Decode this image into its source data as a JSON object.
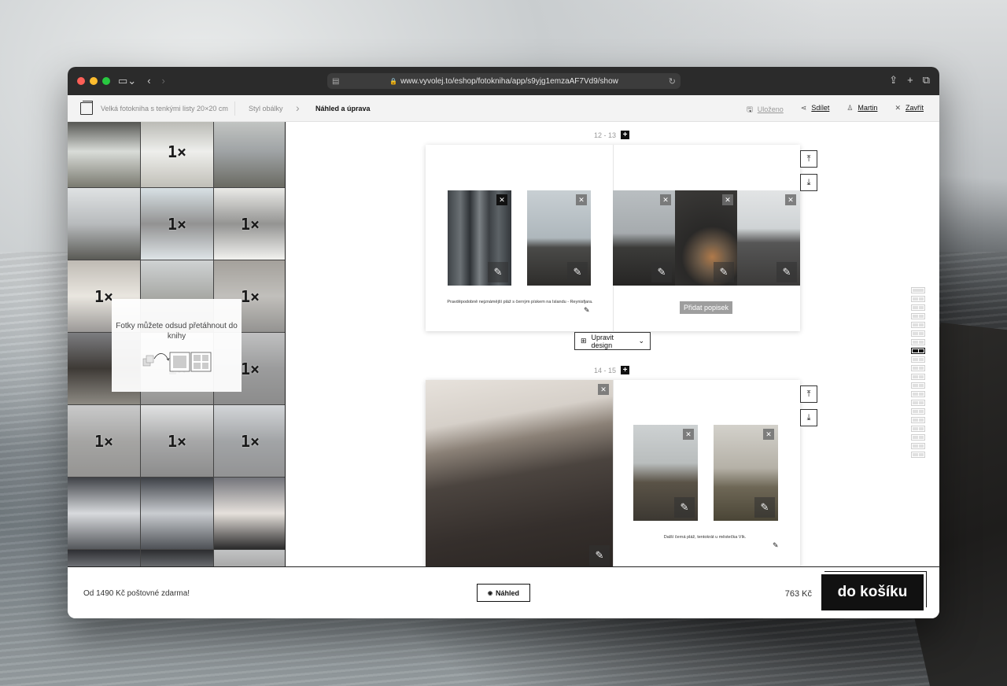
{
  "browser": {
    "url": "www.vyvolej.to/eshop/fotokniha/app/s9yjg1emzaAF7Vd9/show"
  },
  "appbar": {
    "product": "Velká fotokniha s tenkými listy 20×20 cm",
    "step_cover": "Styl obálky",
    "step_current": "Náhled a úprava",
    "saved": "Uloženo",
    "share": "Sdílet",
    "user": "Martin",
    "close": "Zavřít"
  },
  "sidebar": {
    "usage_badge": "1×",
    "tip_text": "Fotky můžete odsud přetáhnout do knihy",
    "thumbs": [
      {
        "used": false,
        "colors": [
          "#3a3a36",
          "#d9dcd8",
          "#7a7a70"
        ]
      },
      {
        "used": true,
        "colors": [
          "#6f6f65",
          "#e0e1dc",
          "#8d8b7d"
        ]
      },
      {
        "used": false,
        "colors": [
          "#c9cbc8",
          "#9fa3a5",
          "#6a6a62"
        ]
      },
      {
        "used": false,
        "colors": [
          "#dfe2e3",
          "#b8bbbd",
          "#5a5a55"
        ]
      },
      {
        "used": true,
        "colors": [
          "#b9c9d0",
          "#3a3a3a",
          "#c4cfd4"
        ]
      },
      {
        "used": true,
        "colors": [
          "#d9d9d4",
          "#3d3d3a",
          "#e8e8e3"
        ]
      },
      {
        "used": true,
        "colors": [
          "#8b8377",
          "#d8d2c6",
          "#4a4642"
        ]
      },
      {
        "used": false,
        "colors": [
          "#cfd2d3",
          "#a9aaa6",
          "#6f6e68"
        ]
      },
      {
        "used": true,
        "colors": [
          "#5a544a",
          "#8e8b84",
          "#3d3b37"
        ]
      },
      {
        "used": false,
        "colors": [
          "#7c7d80",
          "#3e3a36",
          "#8d8a83"
        ]
      },
      {
        "used": true,
        "colors": [
          "#b4b6b7",
          "#6f6f6c",
          "#3d3c3a"
        ]
      },
      {
        "used": true,
        "colors": [
          "#8c8d8e",
          "#4a4b4c",
          "#2e2e2e"
        ]
      },
      {
        "used": true,
        "colors": [
          "#9d9e9f",
          "#5c5b58",
          "#3e3d3a"
        ]
      },
      {
        "used": true,
        "colors": [
          "#c9cbcc",
          "#5f6061",
          "#2e2e2e"
        ]
      },
      {
        "used": true,
        "colors": [
          "#aeb3b8",
          "#565a5e",
          "#3a3b3d"
        ]
      },
      {
        "used": false,
        "colors": [
          "#404348",
          "#d8dadd",
          "#55585c"
        ]
      },
      {
        "used": false,
        "colors": [
          "#3d4046",
          "#c9ccd0",
          "#4e5156"
        ]
      },
      {
        "used": false,
        "colors": [
          "#73747a",
          "#e6e1dc",
          "#2a2a2a"
        ]
      },
      {
        "used": false,
        "colors": [
          "#2e2f33",
          "#b8bcc1",
          "#3a3b3f"
        ]
      },
      {
        "used": false,
        "colors": [
          "#2c2d30",
          "#aeb2b6",
          "#3a3b3e"
        ]
      },
      {
        "used": false,
        "colors": [
          "#c2c3c4",
          "#8a8a88",
          "#4a4a48"
        ]
      }
    ]
  },
  "spreads": [
    {
      "label": "12 - 13",
      "left_caption": "Pravděpodobně nejznámější pláž s černým pískem na Islandu - Reynisfjara.",
      "add_caption": "Přidat popisek"
    },
    {
      "label": "14 - 15",
      "right_caption": "Další černá pláž, tentokrát u městečka Vík."
    }
  ],
  "design_button": "Upravit design",
  "footer": {
    "shipping": "Od 1490 Kč poštovné zdarma!",
    "preview": "Náhled",
    "price": "763 Kč",
    "cart": "do košíku"
  },
  "icons": {
    "close": "✕",
    "edit": "✎",
    "plus": "+",
    "move_up": "⤒",
    "move_down": "⤓",
    "chevron": "⌄",
    "eye": "👁"
  }
}
